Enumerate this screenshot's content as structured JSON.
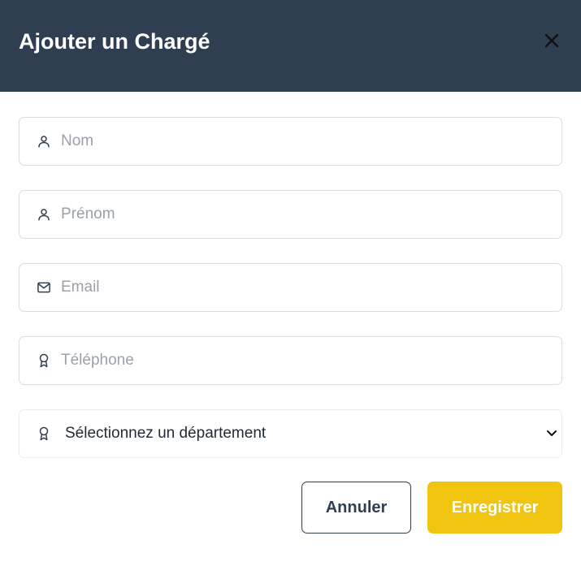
{
  "modal": {
    "title": "Ajouter un Chargé",
    "close_icon": "close-icon"
  },
  "form": {
    "nom": {
      "placeholder": "Nom",
      "value": "",
      "icon": "user-icon"
    },
    "prenom": {
      "placeholder": "Prénom",
      "value": "",
      "icon": "user-icon"
    },
    "email": {
      "placeholder": "Email",
      "value": "",
      "icon": "mail-icon"
    },
    "telephone": {
      "placeholder": "Téléphone",
      "value": "",
      "icon": "award-icon"
    },
    "departement": {
      "selected": "Sélectionnez un département",
      "icon": "award-icon"
    }
  },
  "actions": {
    "cancel_label": "Annuler",
    "save_label": "Enregistrer"
  },
  "colors": {
    "header_bg": "#2f3e51",
    "accent": "#f1c40f",
    "border": "#d9dde3",
    "placeholder": "#9aa1ab"
  }
}
